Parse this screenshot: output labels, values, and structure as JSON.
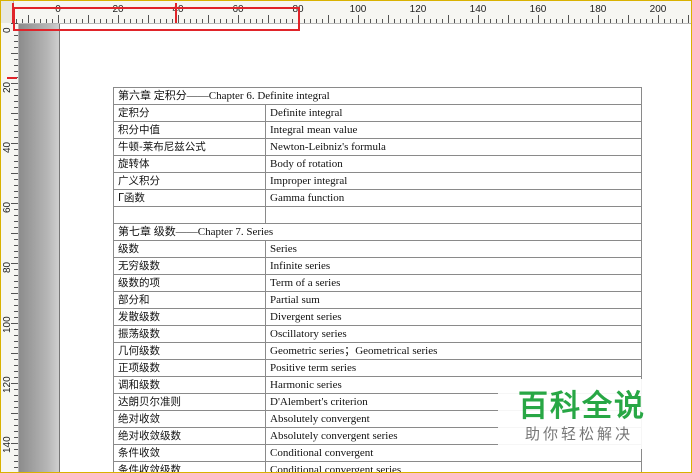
{
  "ruler": {
    "top_labels": [
      "0",
      "20",
      "40",
      "60",
      "80",
      "100",
      "120",
      "140",
      "160",
      "180",
      "200"
    ],
    "left_labels": [
      "0",
      "20",
      "40",
      "60",
      "80",
      "100",
      "120",
      "140"
    ]
  },
  "accent_color": "#e0242a",
  "table": {
    "rows": [
      {
        "zh": "第六章  定积分——Chapter 6.   Definite integral",
        "en": "",
        "header": true
      },
      {
        "zh": "定积分",
        "en": "Definite integral"
      },
      {
        "zh": "积分中值",
        "en": "Integral mean value"
      },
      {
        "zh": "牛顿-莱布尼兹公式",
        "en": "Newton-Leibniz's formula"
      },
      {
        "zh": "旋转体",
        "en": "Body of rotation"
      },
      {
        "zh": "广义积分",
        "en": "Improper integral"
      },
      {
        "zh": "Γ函数",
        "en": "Gamma function"
      },
      {
        "zh": "",
        "en": ""
      },
      {
        "zh": "第七章  级数——Chapter 7.   Series",
        "en": "",
        "header": true
      },
      {
        "zh": "级数",
        "en": "Series"
      },
      {
        "zh": "无穷级数",
        "en": "Infinite series"
      },
      {
        "zh": "级数的项",
        "en": "Term of a series"
      },
      {
        "zh": "部分和",
        "en": "Partial sum"
      },
      {
        "zh": "发散级数",
        "en": "Divergent series"
      },
      {
        "zh": "振荡级数",
        "en": "Oscillatory series"
      },
      {
        "zh": "几何级数",
        "en": "Geometric series；Geometrical series"
      },
      {
        "zh": "正项级数",
        "en": "Positive term series"
      },
      {
        "zh": "调和级数",
        "en": "Harmonic series"
      },
      {
        "zh": "达朗贝尔准则",
        "en": "D'Alembert's criterion"
      },
      {
        "zh": "绝对收敛",
        "en": "Absolutely convergent"
      },
      {
        "zh": "绝对收敛级数",
        "en": "Absolutely convergent series"
      },
      {
        "zh": "条件收敛",
        "en": "Conditional convergent"
      },
      {
        "zh": "条件收敛级数",
        "en": "Conditional convergent series"
      }
    ]
  },
  "watermark": {
    "title": "百科全说",
    "subtitle": "助你轻松解决",
    "color": "#28a745"
  }
}
